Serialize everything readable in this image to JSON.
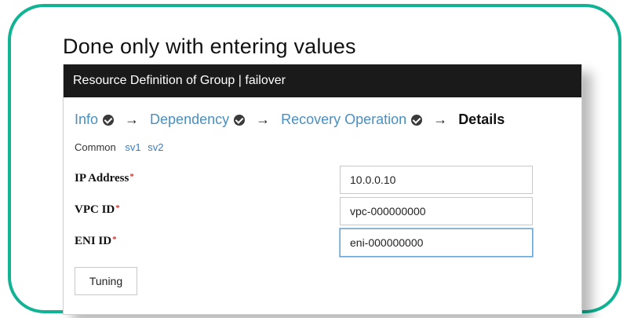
{
  "caption": "Done only with entering values",
  "dialog": {
    "title": "Resource Definition of Group | failover"
  },
  "steps": [
    {
      "label": "Info",
      "done": true
    },
    {
      "label": "Dependency",
      "done": true
    },
    {
      "label": "Recovery Operation",
      "done": true
    },
    {
      "label": "Details",
      "done": false,
      "current": true
    }
  ],
  "arrow_glyph": "→",
  "subtabs": {
    "common": "Common",
    "servers": [
      "sv1",
      "sv2"
    ]
  },
  "fields": {
    "ip_address": {
      "label": "IP Address",
      "required": "*",
      "value": "10.0.0.10"
    },
    "vpc_id": {
      "label": "VPC ID",
      "required": "*",
      "value": "vpc-000000000"
    },
    "eni_id": {
      "label": "ENI ID",
      "required": "*",
      "value": "eni-000000000"
    }
  },
  "buttons": {
    "tuning": "Tuning"
  },
  "colors": {
    "frame_border": "#11b394",
    "titlebar_bg": "#1a1a1a",
    "link": "#4a8fc0",
    "required": "#d0342c"
  }
}
